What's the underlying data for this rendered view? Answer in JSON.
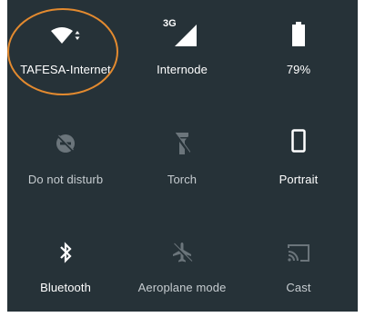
{
  "tiles": {
    "wifi": {
      "label": "TAFESA-Internet",
      "icon": "wifi-icon",
      "state": "on"
    },
    "mobile_data": {
      "label": "Internode",
      "icon": "cellular-signal-icon",
      "network_type": "3G",
      "state": "on"
    },
    "battery": {
      "label": "79%",
      "icon": "battery-icon",
      "level_percent": 79,
      "state": "on"
    },
    "dnd": {
      "label": "Do not disturb",
      "icon": "do-not-disturb-off-icon",
      "state": "off"
    },
    "torch": {
      "label": "Torch",
      "icon": "flashlight-off-icon",
      "state": "off"
    },
    "rotation": {
      "label": "Portrait",
      "icon": "phone-portrait-icon",
      "state": "on"
    },
    "bluetooth": {
      "label": "Bluetooth",
      "icon": "bluetooth-icon",
      "state": "on"
    },
    "airplane": {
      "label": "Aeroplane mode",
      "icon": "airplane-icon",
      "state": "off"
    },
    "cast": {
      "label": "Cast",
      "icon": "cast-icon",
      "state": "off"
    }
  },
  "colors": {
    "panel_background": "#263238",
    "active": "#ffffff",
    "inactive": "#6b757b",
    "annotation": "#e38a2f"
  }
}
